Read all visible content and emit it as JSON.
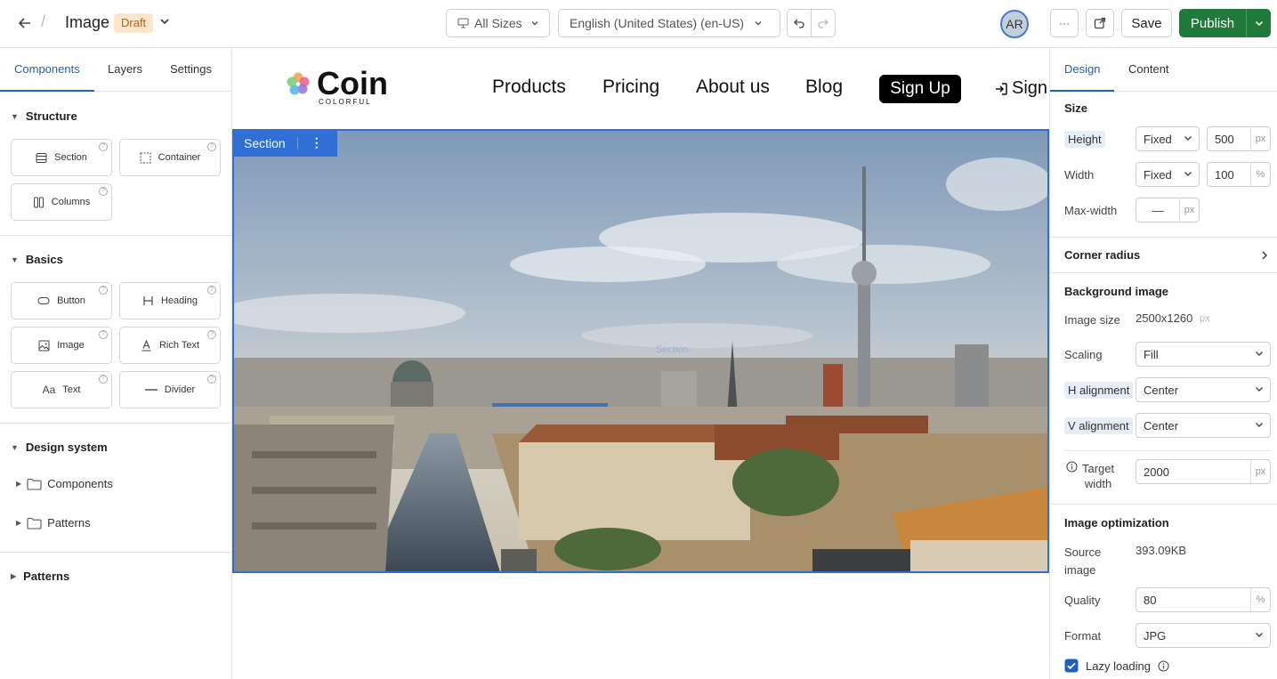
{
  "topbar": {
    "title": "Image",
    "status_badge": "Draft",
    "sizes_select": "All Sizes",
    "locale_select": "English (United States) (en-US)",
    "avatar_initials": "AR",
    "more_label": "···",
    "save_label": "Save",
    "publish_label": "Publish"
  },
  "left": {
    "tabs": [
      "Components",
      "Layers",
      "Settings"
    ],
    "structure": {
      "title": "Structure",
      "items": [
        "Section",
        "Container",
        "Columns"
      ]
    },
    "basics": {
      "title": "Basics",
      "items": [
        "Button",
        "Heading",
        "Image",
        "Rich Text",
        "Text",
        "Divider"
      ]
    },
    "design_system": {
      "title": "Design system",
      "folders": [
        "Components",
        "Patterns"
      ]
    },
    "patterns": {
      "title": "Patterns"
    }
  },
  "canvas": {
    "logo_text": "Coin",
    "logo_sub": "COLORFUL",
    "nav": [
      "Products",
      "Pricing",
      "About us",
      "Blog"
    ],
    "signup_label": "Sign Up",
    "signin_label": "Sign",
    "section_label": "Section",
    "section_ghost": "Section"
  },
  "right": {
    "tabs": [
      "Design",
      "Content"
    ],
    "size": {
      "title": "Size",
      "height_label": "Height",
      "height_mode": "Fixed",
      "height_value": "500",
      "height_unit": "px",
      "width_label": "Width",
      "width_mode": "Fixed",
      "width_value": "100",
      "width_unit": "%",
      "maxwidth_label": "Max-width",
      "maxwidth_value": "—",
      "maxwidth_unit": "px"
    },
    "corner_radius": "Corner radius",
    "background": {
      "title": "Background image",
      "image_size_label": "Image size",
      "image_size_value": "2500x1260",
      "image_size_unit": "px",
      "scaling_label": "Scaling",
      "scaling_value": "Fill",
      "halign_label": "H alignment",
      "halign_value": "Center",
      "valign_label": "V alignment",
      "valign_value": "Center",
      "target_label_1": "Target",
      "target_label_2": "width",
      "target_value": "2000",
      "target_unit": "px"
    },
    "optimization": {
      "title": "Image optimization",
      "source_label_1": "Source",
      "source_label_2": "image",
      "source_value": "393.09KB",
      "quality_label": "Quality",
      "quality_value": "80",
      "quality_unit": "%",
      "format_label": "Format",
      "format_value": "JPG",
      "lazy_label": "Lazy loading"
    }
  },
  "colors": {
    "accent": "#1f5fbf",
    "publish": "#1f7a3c",
    "draft_bg": "#fde6cc",
    "selection": "#2f6fd6"
  }
}
